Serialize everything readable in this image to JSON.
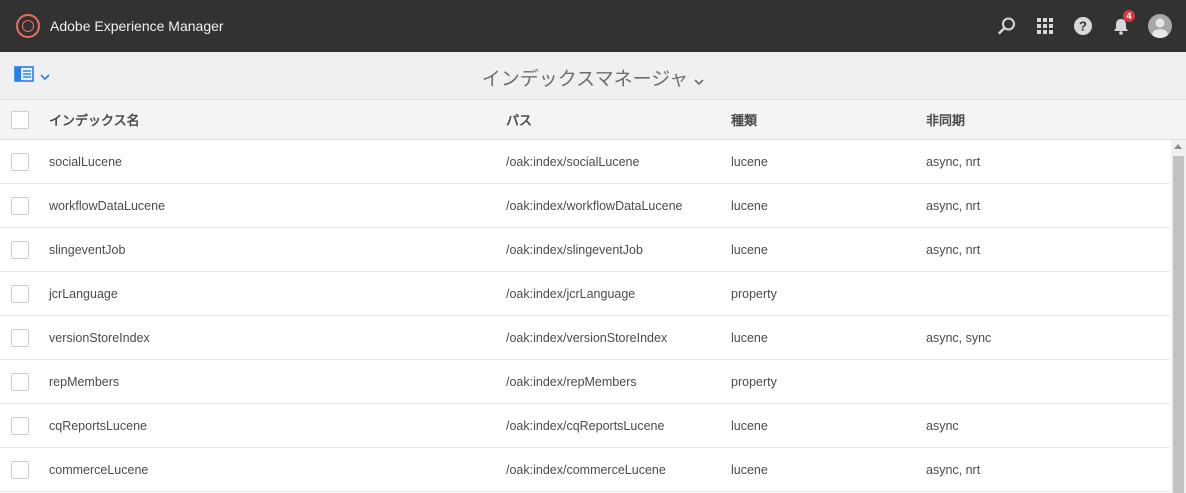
{
  "app": {
    "title": "Adobe Experience Manager",
    "notification_count": "4"
  },
  "page": {
    "title": "インデックスマネージャ"
  },
  "table": {
    "headers": {
      "name": "インデックス名",
      "path": "パス",
      "type": "種類",
      "async": "非同期"
    },
    "rows": [
      {
        "name": "socialLucene",
        "path": "/oak:index/socialLucene",
        "type": "lucene",
        "async": "async, nrt"
      },
      {
        "name": "workflowDataLucene",
        "path": "/oak:index/workflowDataLucene",
        "type": "lucene",
        "async": "async, nrt"
      },
      {
        "name": "slingeventJob",
        "path": "/oak:index/slingeventJob",
        "type": "lucene",
        "async": "async, nrt"
      },
      {
        "name": "jcrLanguage",
        "path": "/oak:index/jcrLanguage",
        "type": "property",
        "async": ""
      },
      {
        "name": "versionStoreIndex",
        "path": "/oak:index/versionStoreIndex",
        "type": "lucene",
        "async": "async, sync"
      },
      {
        "name": "repMembers",
        "path": "/oak:index/repMembers",
        "type": "property",
        "async": ""
      },
      {
        "name": "cqReportsLucene",
        "path": "/oak:index/cqReportsLucene",
        "type": "lucene",
        "async": "async"
      },
      {
        "name": "commerceLucene",
        "path": "/oak:index/commerceLucene",
        "type": "lucene",
        "async": "async, nrt"
      }
    ]
  },
  "icons": {
    "logo": "aem-logo-icon",
    "search": "search-icon",
    "apps": "apps-grid-icon",
    "help": "help-icon",
    "notifications": "bell-icon",
    "user": "user-avatar-icon",
    "rail": "rail-toggle-icon",
    "chevron": "chevron-down-icon"
  },
  "colors": {
    "topbar": "#323232",
    "accent": "#2680eb",
    "logo": "#e8705a",
    "badge": "#d7373f"
  }
}
